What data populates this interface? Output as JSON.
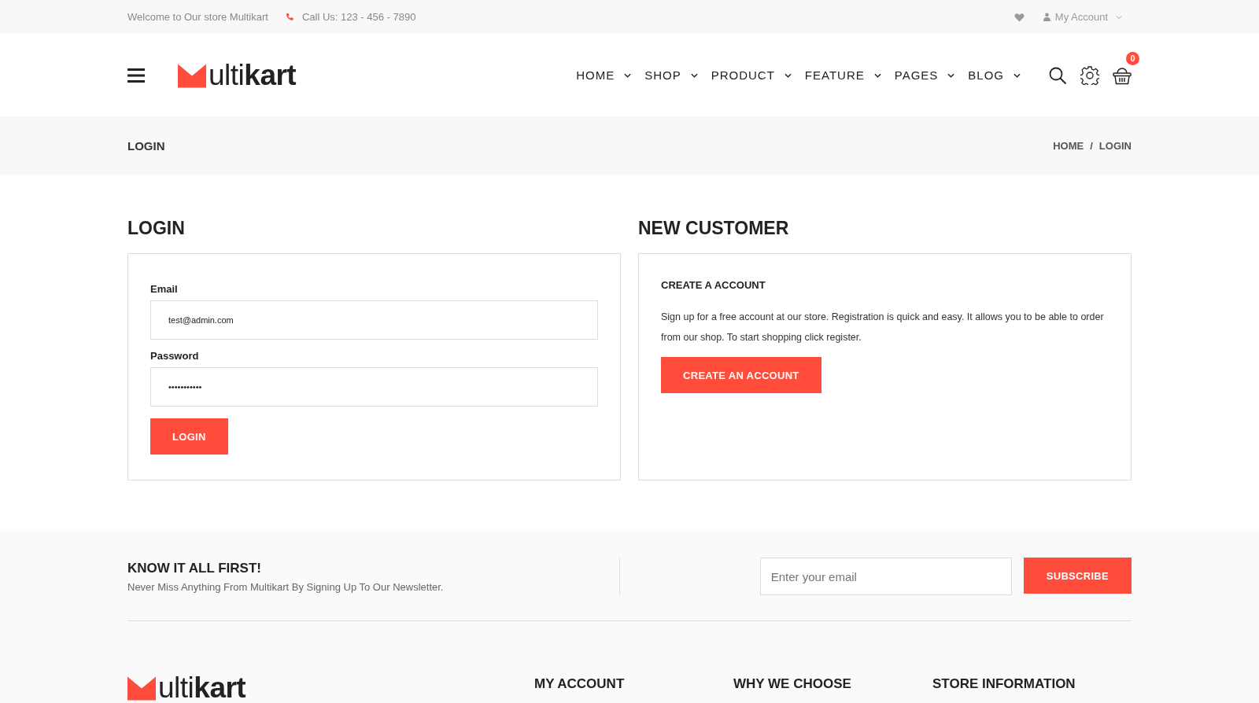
{
  "top_bar": {
    "welcome": "Welcome to Our store Multikart",
    "phone": "Call Us: 123 - 456 - 7890",
    "account": "My Account"
  },
  "header": {
    "logo": "ulti**kart**",
    "nav": [
      {
        "label": "HOME"
      },
      {
        "label": "SHOP"
      },
      {
        "label": "PRODUCT"
      },
      {
        "label": "FEATURE"
      },
      {
        "label": "PAGES"
      },
      {
        "label": "BLOG"
      }
    ],
    "cart_count": "0"
  },
  "breadcrumb": {
    "title": "LOGIN",
    "trail": [
      "HOME",
      "LOGIN"
    ],
    "separator": "/"
  },
  "login": {
    "heading": "LOGIN",
    "fields": [
      {
        "label": "Email",
        "value": "test@admin.com"
      },
      {
        "label": "Password",
        "value": "•••••••••••"
      }
    ],
    "button": "LOGIN"
  },
  "new_customer": {
    "heading": "NEW CUSTOMER",
    "subheading": "CREATE A ACCOUNT",
    "text": "Sign up for a free account at our store. Registration is quick and easy. It allows you to be able to order from our shop. To start shopping click register.",
    "button": "CREATE AN ACCOUNT"
  },
  "newsletter": {
    "title": "KNOW IT ALL FIRST!",
    "text": "Never Miss Anything From Multikart By Signing Up To Our Newsletter.",
    "placeholder": "Enter your email",
    "button": "SUBSCRIBE"
  },
  "footer": {
    "logo": "ulti**kart**",
    "columns": [
      "MY ACCOUNT",
      "WHY WE CHOOSE",
      "STORE INFORMATION"
    ]
  }
}
